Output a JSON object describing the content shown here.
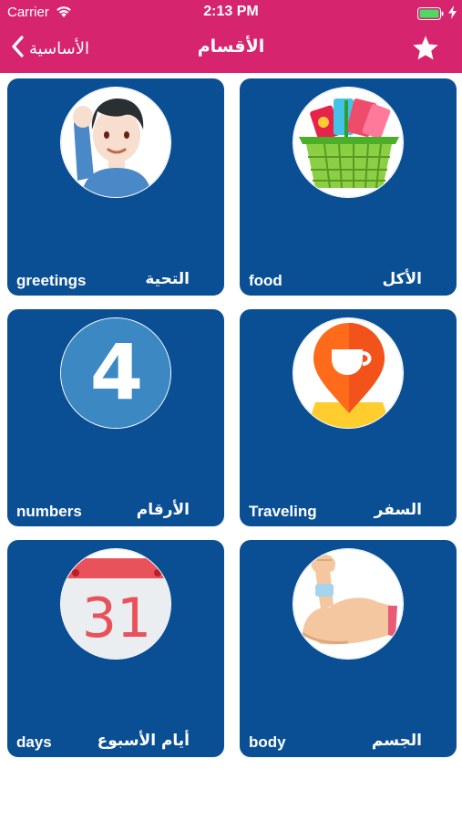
{
  "status_bar": {
    "carrier": "Carrier",
    "time": "2:13 PM"
  },
  "nav": {
    "back_label": "الأساسية",
    "title": "الأقسام"
  },
  "categories": [
    {
      "english": "greetings",
      "arabic": "التحية",
      "icon": "waving-boy-icon"
    },
    {
      "english": "food",
      "arabic": "الأكل",
      "icon": "grocery-basket-icon"
    },
    {
      "english": "numbers",
      "arabic": "الأرقام",
      "icon": "number-four-icon",
      "icon_text": "4"
    },
    {
      "english": "Traveling",
      "arabic": "السفر",
      "icon": "coffee-location-pin-icon"
    },
    {
      "english": "days",
      "arabic": "أيام الأسبوع",
      "icon": "calendar-icon",
      "icon_text": "31"
    },
    {
      "english": "body",
      "arabic": "الجسم",
      "icon": "flexed-bicep-icon"
    }
  ],
  "colors": {
    "header": "#d6246e",
    "card": "#0a4f93",
    "text": "#ffffff"
  }
}
